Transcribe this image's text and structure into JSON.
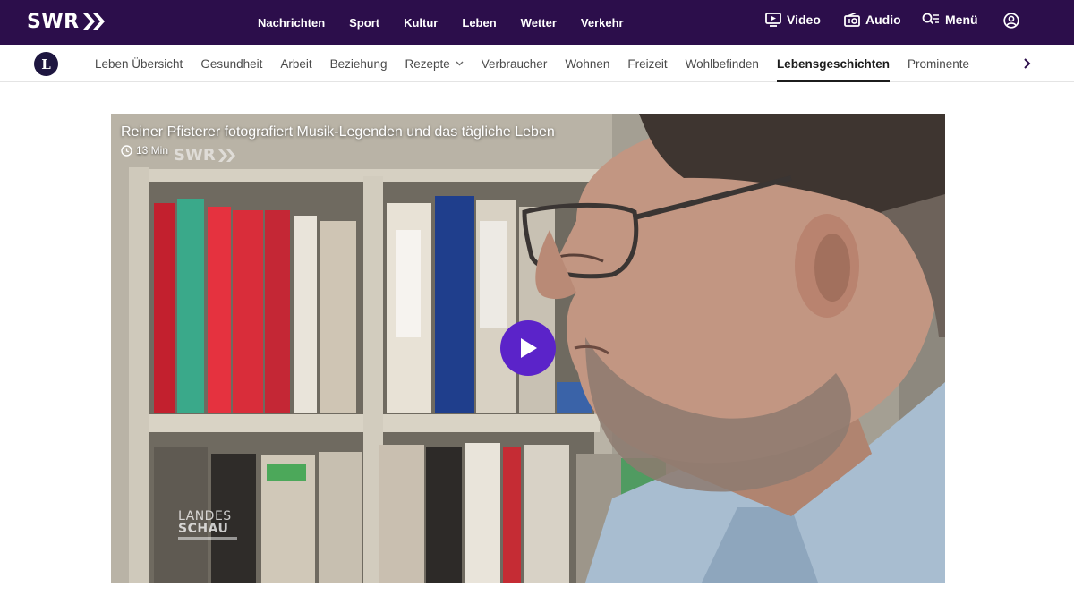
{
  "header": {
    "logo_text": "SWR",
    "nav": [
      "Nachrichten",
      "Sport",
      "Kultur",
      "Leben",
      "Wetter",
      "Verkehr"
    ],
    "video_label": "Video",
    "audio_label": "Audio",
    "menu_label": "Menü"
  },
  "subnav": {
    "badge": "L",
    "items": [
      "Leben Übersicht",
      "Gesundheit",
      "Arbeit",
      "Beziehung",
      "Rezepte",
      "Verbraucher",
      "Wohnen",
      "Freizeit",
      "Wohlbefinden",
      "Lebensgeschichten",
      "Prominente"
    ],
    "active_item": "Lebensgeschichten",
    "dropdown_item": "Rezepte"
  },
  "video": {
    "title": "Reiner Pfisterer fotografiert Musik-Legenden und das tägliche Leben",
    "duration": "13 Min",
    "watermark": "SWR",
    "show_logo_line1": "LANDES",
    "show_logo_line2": "SCHAU"
  },
  "colors": {
    "header_bg": "#2c0e4b",
    "play_button": "#5b23c9",
    "active_underline": "#1c1c1c"
  },
  "icons": [
    "swr-logo-chevrons-icon",
    "video-icon",
    "radio-icon",
    "search-menu-icon",
    "user-account-icon",
    "chevron-right-icon",
    "clock-icon",
    "play-icon"
  ]
}
